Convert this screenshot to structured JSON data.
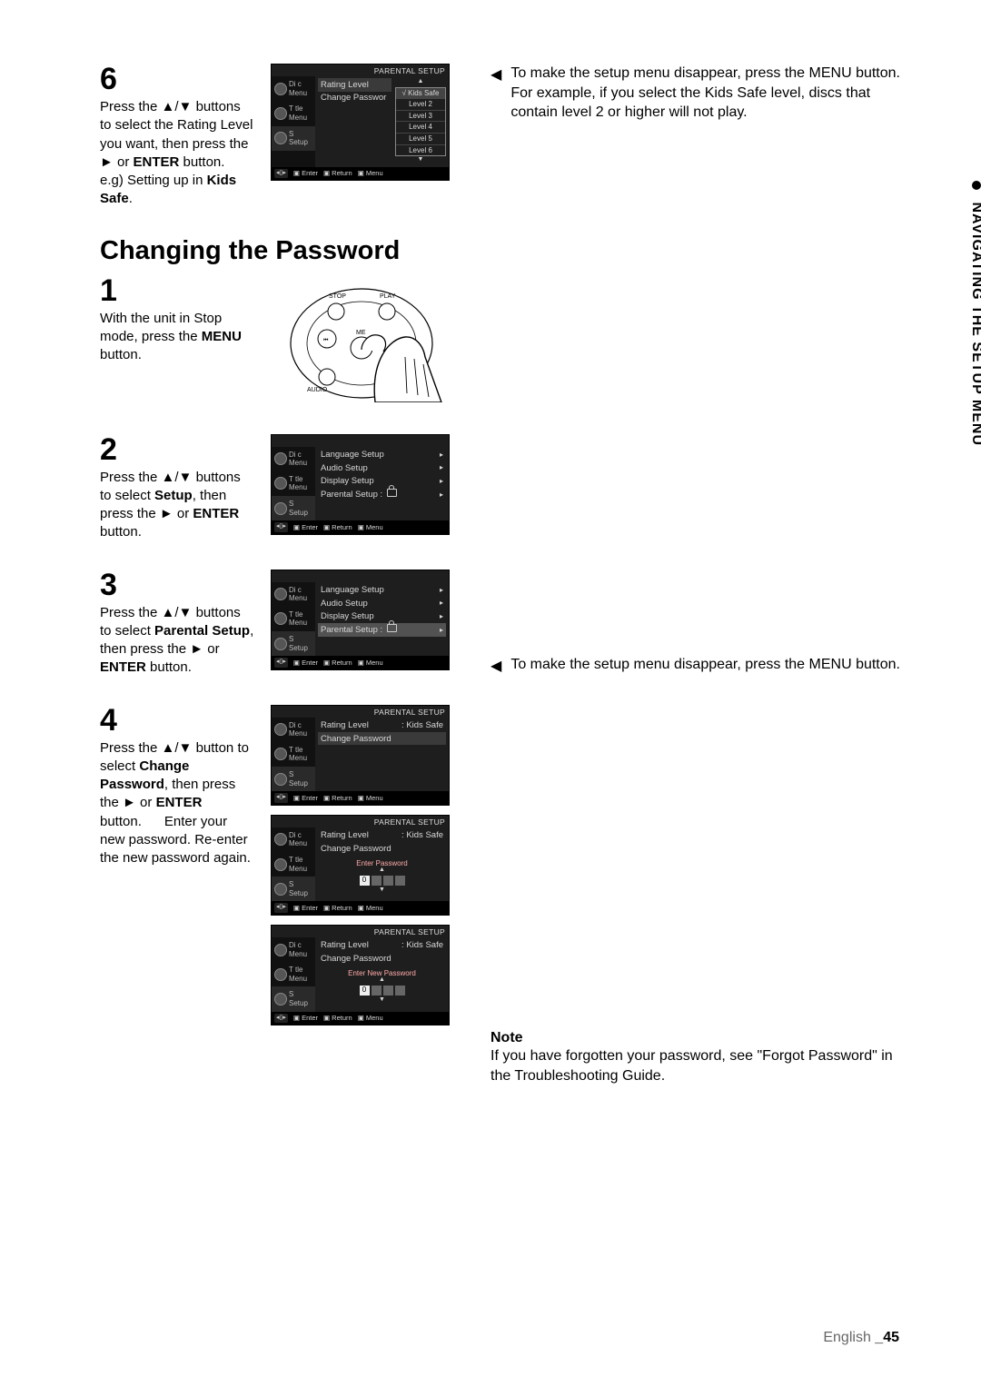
{
  "sideTab": "NAVIGATING THE SETUP MENU",
  "footer": {
    "lang": "English",
    "page": "_45"
  },
  "step6": {
    "num": "6",
    "text_pre": "Press the ",
    "text_arrows": "▲/▼",
    "text_mid": " buttons to select the Rating Level you want, then press the ",
    "text_play": "►",
    "text_or": " or ",
    "text_enter": "ENTER",
    "text_post": " button.",
    "text_eg_pre": "e.g) Setting up in ",
    "text_eg_bold": "Kids Safe",
    "text_eg_post": "."
  },
  "osd6": {
    "title": "PARENTAL SETUP",
    "nav": [
      "Di c Menu",
      "T tle Menu",
      "S  Setup"
    ],
    "rows": [
      {
        "label": "Rating Level",
        "arrow": "▲"
      },
      {
        "label": "Change Passwor",
        "sub": true
      }
    ],
    "sub": [
      "√  Kids Safe",
      "Level 2",
      "Level 3",
      "Level 4",
      "Level 5",
      "Level 6"
    ],
    "subArrowDown": "▼",
    "foot": [
      "Enter",
      "Return",
      "Menu"
    ],
    "footNav": "◂▯▸"
  },
  "rightTop": {
    "items": [
      "To make the setup menu disappear, press the MENU button.",
      "For example, if you select the Kids Safe level, discs that contain level 2 or higher will not play."
    ]
  },
  "sectionTitle": "Changing the Password",
  "step1": {
    "num": "1",
    "text_pre": "With the unit in Stop mode, press the ",
    "text_bold": "MENU",
    "text_post": " button."
  },
  "remote": {
    "labels": {
      "stop": "STOP",
      "play": "PLAY",
      "menu": "ME",
      "audio": "AUDIO"
    }
  },
  "osdList": {
    "nav": [
      "Di c Menu",
      "T tle Menu",
      "S  Setup"
    ],
    "rows": [
      "Language Setup",
      "Audio Setup",
      "Display Setup",
      "Parental Setup :"
    ],
    "foot": [
      "Enter",
      "Return",
      "Menu"
    ],
    "footNav": "◂▯▸"
  },
  "step2": {
    "num": "2",
    "text_pre": "Press the ",
    "text_arrows": "▲/▼",
    "text_mid1": " buttons to select ",
    "text_bold": "Setup",
    "text_mid2": ", then press the ",
    "text_play": "►",
    "text_or": " or ",
    "text_enter": "ENTER",
    "text_post": " button."
  },
  "step3": {
    "num": "3",
    "text_pre": "Press the ",
    "text_arrows": "▲/▼",
    "text_mid1": " buttons to select ",
    "text_bold": "Parental Setup",
    "text_mid2": ", then press the ",
    "text_play": "►",
    "text_or": " or ",
    "text_enter": "ENTER",
    "text_post": " button."
  },
  "rightMid": {
    "item": "To make the setup menu disappear, press the MENU button."
  },
  "step4": {
    "num": "4",
    "text_pre": "Press the ",
    "text_arrows": "▲/▼",
    "text_mid1": " button to select ",
    "text_bold": "Change Password",
    "text_mid2": ", then press the ",
    "text_play": "►",
    "text_or": " or ",
    "text_enter": "ENTER",
    "text_post1": " button.",
    "text_post2": "Enter your new password. Re-enter the new password again."
  },
  "osd4a": {
    "title": "PARENTAL SETUP",
    "rows": [
      {
        "label": "Rating Level",
        "val": ": Kids Safe"
      },
      {
        "label": "Change Password",
        "hl": true
      }
    ]
  },
  "osd4b": {
    "title": "PARENTAL SETUP",
    "rows": [
      {
        "label": "Rating Level",
        "val": ": Kids Safe"
      },
      {
        "label": "Change Password"
      }
    ],
    "entry": {
      "label": "Enter Password",
      "digit": "0"
    }
  },
  "osd4c": {
    "title": "PARENTAL SETUP",
    "rows": [
      {
        "label": "Rating Level",
        "val": ": Kids Safe"
      },
      {
        "label": "Change Password"
      }
    ],
    "entry": {
      "label": "Enter New Password",
      "digit": "0"
    }
  },
  "note": {
    "head": "Note",
    "body": "If you have forgotten your password, see \"Forgot Password\" in the Troubleshooting Guide."
  }
}
